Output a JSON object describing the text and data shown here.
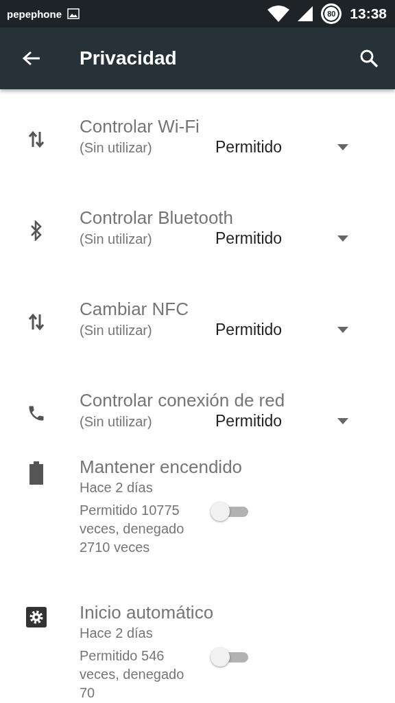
{
  "status_bar": {
    "carrier": "pepephone",
    "battery_percent": "80",
    "time": "13:38"
  },
  "app_bar": {
    "title": "Privacidad"
  },
  "permissions": [
    {
      "kind": "dropdown",
      "title": "Controlar Wi-Fi",
      "subtitle": "(Sin utilizar)",
      "value": "Permitido"
    },
    {
      "kind": "dropdown",
      "title": "Controlar Bluetooth",
      "subtitle": "(Sin utilizar)",
      "value": "Permitido"
    },
    {
      "kind": "dropdown",
      "title": "Cambiar NFC",
      "subtitle": "(Sin utilizar)",
      "value": "Permitido"
    },
    {
      "kind": "dropdown",
      "title": "Controlar conexión de red",
      "subtitle": "(Sin utilizar)",
      "value": "Permitido"
    },
    {
      "kind": "toggle",
      "title": "Mantener encendido",
      "subtitle": "Hace 2 días",
      "detail": "Permitido 10775 veces, denegado 2710 veces",
      "checked": false
    },
    {
      "kind": "toggle",
      "title": "Inicio automático",
      "subtitle": "Hace 2 días",
      "detail": "Permitido 546 veces, denegado 70",
      "checked": false
    }
  ]
}
